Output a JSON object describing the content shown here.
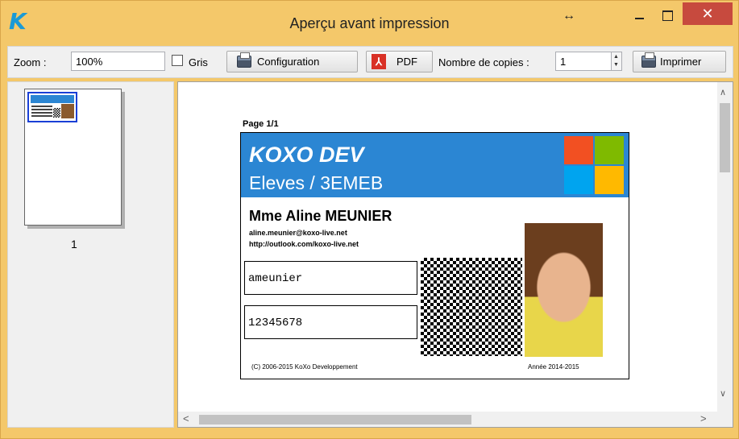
{
  "window": {
    "title": "Aperçu avant impression",
    "app_logo": "K",
    "close_symbol": "✕",
    "resize_symbol": "↔"
  },
  "toolbar": {
    "zoom_label": "Zoom :",
    "zoom_value": "100%",
    "grey_label": "Gris",
    "grey_checked": false,
    "config_label": "Configuration",
    "pdf_label": "PDF",
    "pdf_icon_glyph": "⅄",
    "copies_label": "Nombre de copies :",
    "copies_value": "1",
    "print_label": "Imprimer"
  },
  "thumbnails": {
    "pages": [
      {
        "number": "1",
        "selected": true
      }
    ]
  },
  "preview": {
    "page_label": "Page 1/1",
    "card": {
      "company": "KOXO DEV",
      "group": "Eleves / 3EMEB",
      "person": "Mme Aline MEUNIER",
      "email": "aline.meunier@koxo-live.net",
      "url": "http://outlook.com/koxo-live.net",
      "login": "ameunier",
      "id_number": "12345678",
      "copyright": "(C) 2006-2015 KoXo Developpement",
      "school_year": "Année 2014-2015",
      "header_color": "#2b86d3",
      "logo_colors": [
        "#f25022",
        "#7fba00",
        "#00a4ef",
        "#ffb900"
      ]
    }
  },
  "icons": {
    "app": "koxo-k-logo",
    "config": "printer-setup-icon",
    "pdf": "pdf-icon",
    "print": "printer-icon"
  },
  "scroll": {
    "up": "∧",
    "down": "∨",
    "left": "<",
    "right": ">"
  }
}
